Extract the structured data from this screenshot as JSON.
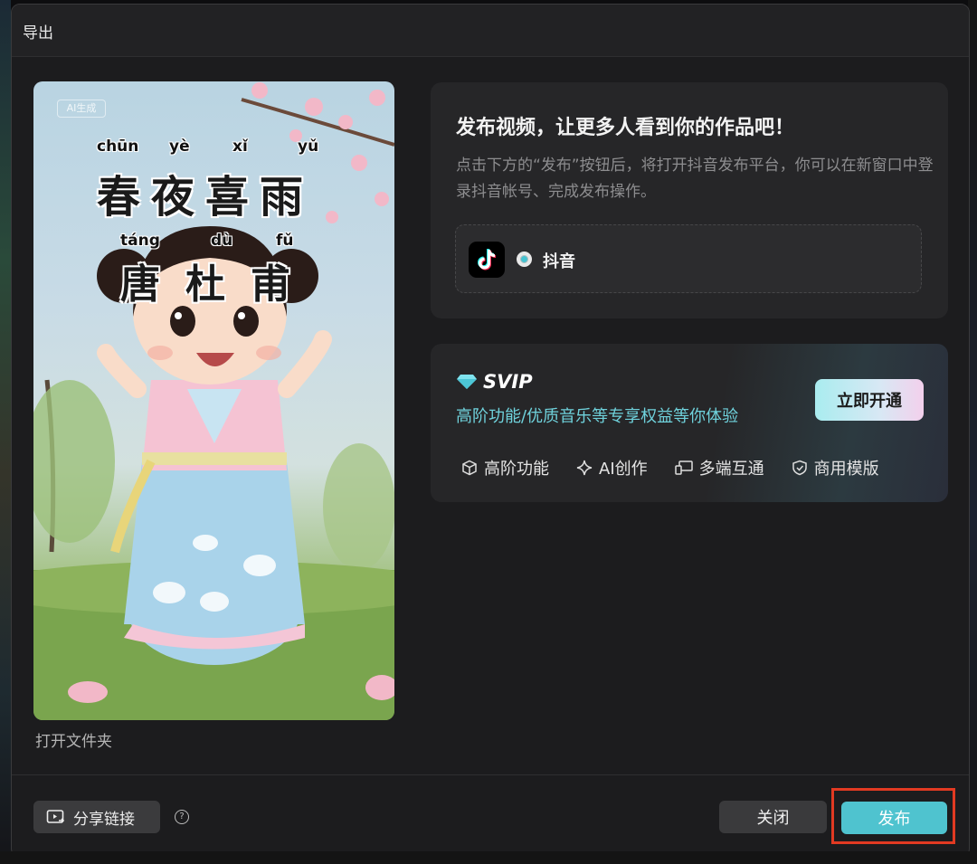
{
  "dialog": {
    "title": "导出"
  },
  "preview": {
    "watermark": "AI生成",
    "poem_title": "春夜喜雨",
    "poem_title_pinyin": [
      "chūn",
      "yè",
      "xǐ",
      "yǔ"
    ],
    "author": "唐杜甫",
    "author_pinyin": [
      "táng",
      "dù",
      "fǔ"
    ],
    "open_folder_label": "打开文件夹"
  },
  "publish_card": {
    "heading": "发布视频，让更多人看到你的作品吧！",
    "description": "点击下方的“发布”按钮后，将打开抖音发布平台，你可以在新窗口中登录抖音帐号、完成发布操作。",
    "platform": {
      "icon": "tiktok-icon",
      "label": "抖音",
      "selected": true
    }
  },
  "svip_card": {
    "badge_icon": "diamond-icon",
    "title": "SVIP",
    "subtitle": "高阶功能/优质音乐等专享权益等你体验",
    "open_button": "立即开通",
    "features": [
      {
        "icon": "cube-icon",
        "label": "高阶功能"
      },
      {
        "icon": "sparkle-icon",
        "label": "AI创作"
      },
      {
        "icon": "devices-icon",
        "label": "多端互通"
      },
      {
        "icon": "shield-check-icon",
        "label": "商用模版"
      }
    ]
  },
  "footer": {
    "share_button": "分享链接",
    "help_icon": "help-icon",
    "close_button": "关闭",
    "publish_button": "发布"
  },
  "colors": {
    "accent": "#4fc3cf",
    "highlight_border": "#e23a22",
    "dialog_bg": "#1c1c1e"
  }
}
